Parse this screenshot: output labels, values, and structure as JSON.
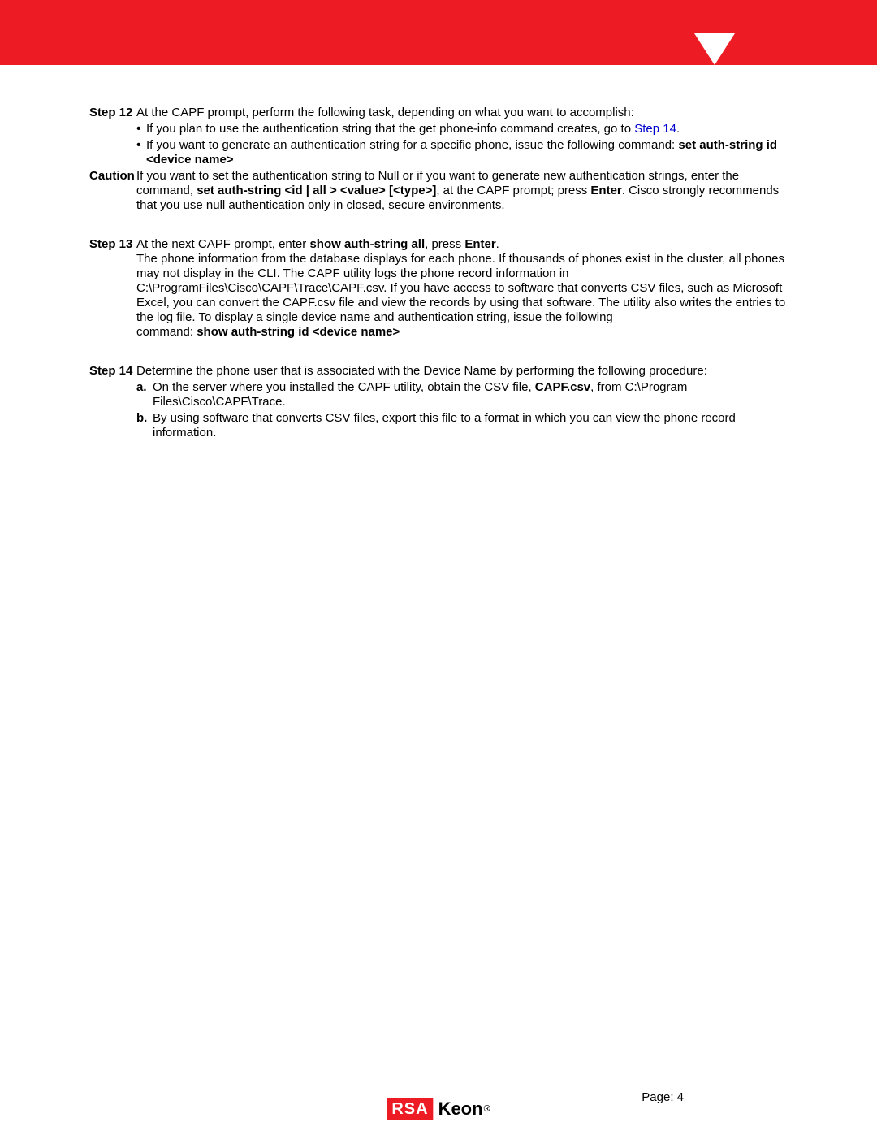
{
  "step12": {
    "label": "Step 12",
    "intro": " At the CAPF prompt, perform the following task, depending on what you want to accomplish:",
    "bullet1_a": "If you plan to use the authentication string that the get phone-info command creates, go to ",
    "bullet1_link": "Step 14",
    "bullet1_b": ".",
    "bullet2_a": "If you want to generate an authentication string for a specific phone, issue the following command: ",
    "bullet2_bold": "set auth-string id <device name>"
  },
  "caution": {
    "label": "Caution",
    "text_a": " If you want to set the authentication string to Null or if you want to generate new authentication strings, enter the command, ",
    "bold1": "set auth-string <id | all > <value> [<type>]",
    "text_b": ", at the CAPF prompt; press ",
    "bold2": "Enter",
    "text_c": ".  Cisco strongly recommends that you use null authentication only in closed, secure environments."
  },
  "step13": {
    "label": "Step 13",
    "line1_a": " At the next CAPF prompt, enter ",
    "line1_bold1": "show auth-string all",
    "line1_b": ", press ",
    "line1_bold2": "Enter",
    "line1_c": ".",
    "para": "The phone information from the database displays for each phone. If thousands of phones exist in the cluster, all phones may not display in the CLI. The CAPF utility logs the phone record information in C:\\ProgramFiles\\Cisco\\CAPF\\Trace\\CAPF.csv. If you have access to software that converts CSV files, such as Microsoft Excel, you can convert the CAPF.csv file and view the records by using that software. The utility also writes the entries to the log file.  To display a single device name and authentication string, issue the following",
    "cmd_a": "command: ",
    "cmd_bold": "show auth-string id <device name>"
  },
  "step14": {
    "label": "Step 14",
    "intro": " Determine the phone user that is associated with the Device Name by performing the following procedure:",
    "a_label": "a.",
    "a_text_a": " On the server where you installed the CAPF utility, obtain the CSV file, ",
    "a_bold": "CAPF.csv",
    "a_text_b": ", from C:\\Program Files\\Cisco\\CAPF\\Trace.",
    "b_label": "b.",
    "b_text": " By using software that converts CSV files, export this file to a format in which you can view the phone record information."
  },
  "footer": {
    "rsa": "RSA",
    "keon": "Keon",
    "reg": "®",
    "page": "Page: 4"
  }
}
